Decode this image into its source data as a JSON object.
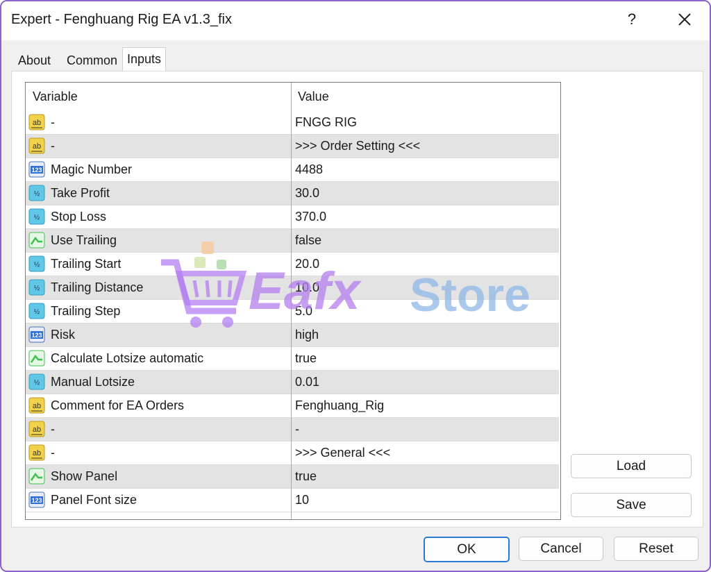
{
  "window": {
    "title": "Expert - Fenghuang Rig EA v1.3_fix",
    "help_label": "?",
    "close_icon": "close-icon"
  },
  "tabs": [
    {
      "label": "About"
    },
    {
      "label": "Common"
    },
    {
      "label": "Inputs",
      "active": true
    }
  ],
  "grid": {
    "header_variable": "Variable",
    "header_value": "Value",
    "rows": [
      {
        "icon": "string",
        "variable": "-",
        "value": "FNGG RIG"
      },
      {
        "icon": "string",
        "variable": "-",
        "value": ">>> Order Setting <<<"
      },
      {
        "icon": "integer",
        "variable": "Magic Number",
        "value": "4488"
      },
      {
        "icon": "double",
        "variable": "Take Profit",
        "value": "30.0"
      },
      {
        "icon": "double",
        "variable": "Stop Loss",
        "value": "370.0"
      },
      {
        "icon": "bool",
        "variable": "Use Trailing",
        "value": "false"
      },
      {
        "icon": "double",
        "variable": "Trailing Start",
        "value": "20.0"
      },
      {
        "icon": "double",
        "variable": "Trailing Distance",
        "value": "10.0"
      },
      {
        "icon": "double",
        "variable": "Trailing Step",
        "value": "5.0"
      },
      {
        "icon": "integer",
        "variable": "Risk",
        "value": "high"
      },
      {
        "icon": "bool",
        "variable": "Calculate Lotsize automatic",
        "value": "true"
      },
      {
        "icon": "double",
        "variable": "Manual Lotsize",
        "value": "0.01"
      },
      {
        "icon": "string",
        "variable": "Comment for EA Orders",
        "value": "Fenghuang_Rig"
      },
      {
        "icon": "string",
        "variable": "-",
        "value": "-"
      },
      {
        "icon": "string",
        "variable": "-",
        "value": ">>> General <<<"
      },
      {
        "icon": "bool",
        "variable": "Show Panel",
        "value": "true"
      },
      {
        "icon": "integer",
        "variable": "Panel Font size",
        "value": "10"
      }
    ]
  },
  "side_buttons": {
    "load": "Load",
    "save": "Save"
  },
  "footer_buttons": {
    "ok": "OK",
    "cancel": "Cancel",
    "reset": "Reset"
  },
  "watermark": {
    "text1": "Eafx",
    "text2": "Store"
  },
  "colors": {
    "accent_border": "#8a63d2",
    "ok_border": "#2b7bd6",
    "string_icon": "#f2d24a",
    "integer_icon": "#2f6fd8",
    "double_icon": "#5fc7e8",
    "bool_icon": "#3fbf4f"
  }
}
